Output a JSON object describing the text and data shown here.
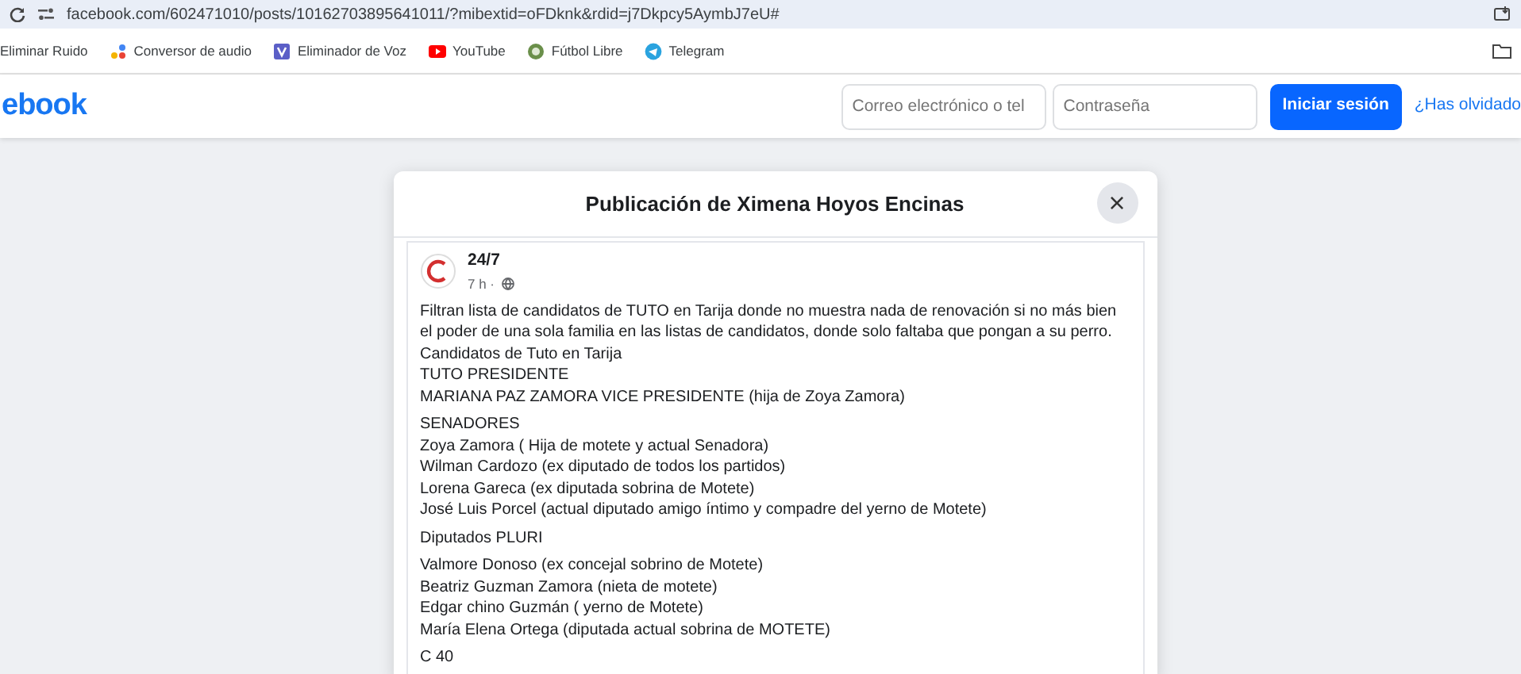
{
  "browser": {
    "url": "facebook.com/602471010/posts/10162703895641011/?mibextid=oFDknk&rdid=j7Dkpcy5AymbJ7eU#",
    "bookmarks": [
      {
        "label": "Eliminar Ruido"
      },
      {
        "label": "Conversor de audio"
      },
      {
        "label": "Eliminador de Voz"
      },
      {
        "label": "YouTube"
      },
      {
        "label": "Fútbol Libre"
      },
      {
        "label": "Telegram"
      }
    ]
  },
  "header": {
    "logo": "ebook",
    "email": {
      "placeholder": "Correo electrónico o tel"
    },
    "password": {
      "placeholder": "Contraseña"
    },
    "login_button": "Iniciar sesión",
    "forgot_link": "¿Has olvidado"
  },
  "modal": {
    "title": "Publicación de Ximena Hoyos Encinas",
    "close": "×",
    "post": {
      "author": "24/7",
      "time": "7 h ·",
      "paragraphs": [
        [
          "Filtran lista de candidatos de TUTO en Tarija donde no muestra nada de renovación si no más bien el poder de una sola familia en las listas de candidatos, donde solo faltaba que pongan a su perro.",
          "Candidatos de Tuto en Tarija",
          "TUTO PRESIDENTE",
          "MARIANA PAZ ZAMORA VICE PRESIDENTE (hija de Zoya Zamora)"
        ],
        [
          "SENADORES",
          "Zoya Zamora ( Hija de motete y actual Senadora)",
          "Wilman Cardozo (ex diputado de todos los partidos)",
          "Lorena Gareca (ex diputada sobrina de Motete)",
          "José Luis Porcel (actual diputado amigo íntimo y compadre del yerno de Motete)"
        ],
        [
          "Diputados PLURI"
        ],
        [
          "Valmore Donoso (ex concejal sobrino de Motete)",
          "Beatriz Guzman Zamora (nieta de motete)",
          "Edgar chino Guzmán ( yerno de Motete)",
          "María Elena Ortega (diputada actual sobrina de MOTETE)"
        ],
        [
          "C 40"
        ]
      ]
    }
  }
}
